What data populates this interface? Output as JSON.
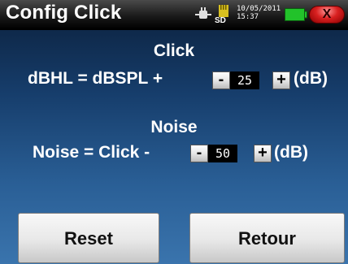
{
  "header": {
    "title": "Config Click",
    "sd_label": "SD",
    "date_line1": "10/05/2011",
    "date_line2": "15:37",
    "close_label": "X",
    "icons": [
      "plug-icon",
      "sd-card-icon",
      "battery-icon",
      "close-icon"
    ],
    "colors": {
      "battery": "#22c22a",
      "close": "#d92020"
    }
  },
  "click": {
    "heading": "Click",
    "formula": "dBHL = dBSPL +",
    "minus_label": "-",
    "plus_label": "+",
    "value": "25",
    "unit": "(dB)"
  },
  "noise": {
    "heading": "Noise",
    "formula": "Noise = Click -",
    "minus_label": "-",
    "plus_label": "+",
    "value": "50",
    "unit": "(dB)"
  },
  "buttons": {
    "reset": "Reset",
    "retour": "Retour"
  }
}
